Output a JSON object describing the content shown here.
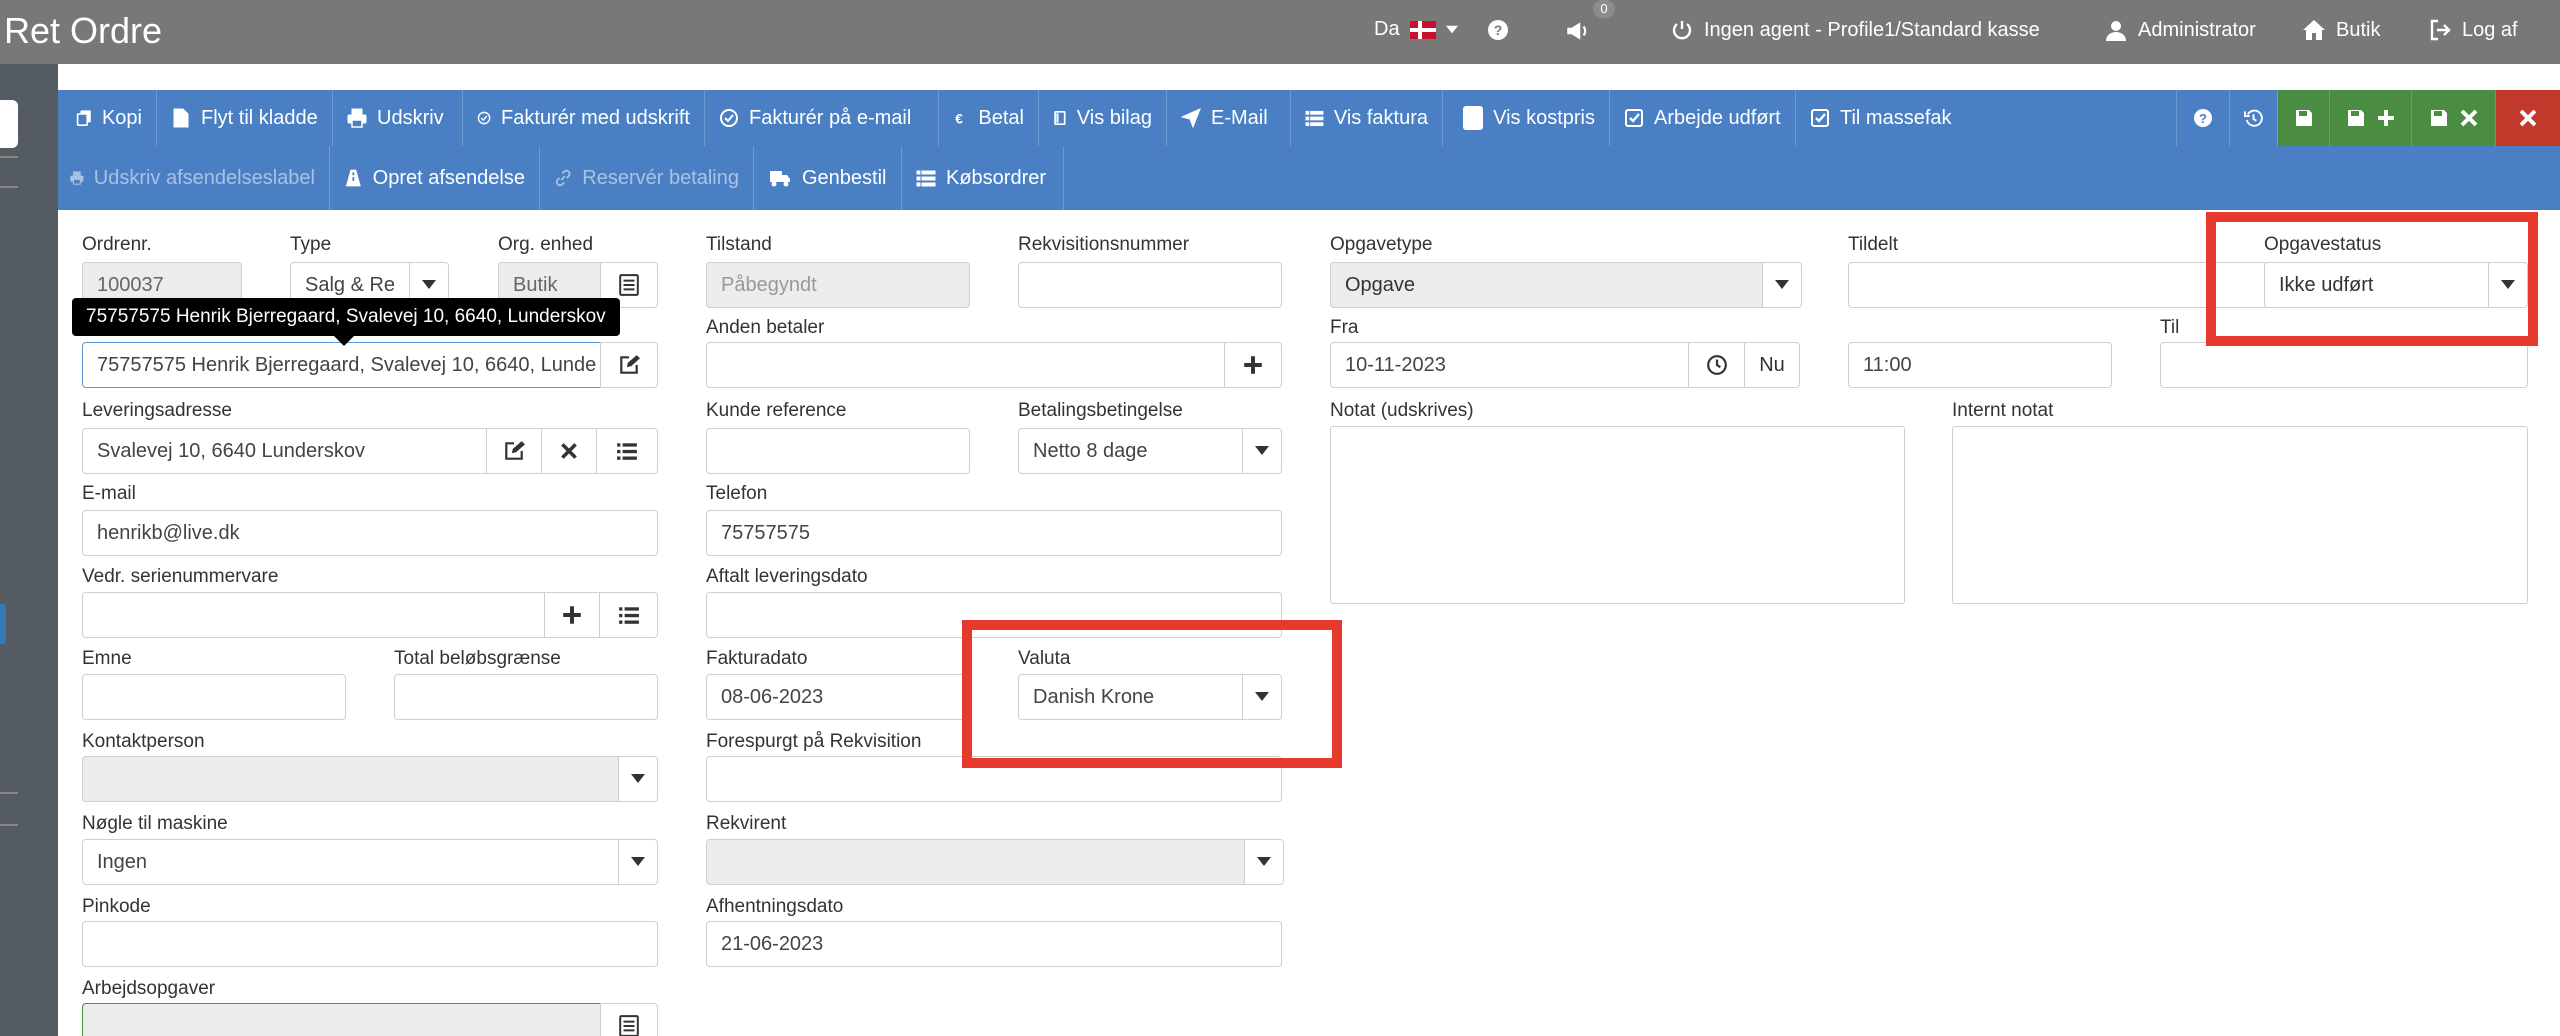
{
  "header": {
    "title": "Ret Ordre",
    "language": "Da",
    "notification_count": "0",
    "agent_status": "Ingen agent - Profile1/Standard kasse",
    "user": "Administrator",
    "shop": "Butik",
    "logout": "Log af"
  },
  "toolbar": {
    "row1": [
      "Kopi",
      "Flyt til kladde",
      "Udskriv",
      "Fakturér med udskrift",
      "Fakturér på e-mail",
      "Betal",
      "Vis bilag",
      "E-Mail",
      "Vis faktura",
      "Vis kostpris",
      "Arbejde udført",
      "Til massefak"
    ],
    "row2": [
      "Udskriv afsendelseslabel",
      "Opret afsendelse",
      "Reservér betaling",
      "Genbestil",
      "Købsordrer"
    ]
  },
  "tooltip": "75757575 Henrik Bjerregaard, Svalevej 10, 6640, Lunderskov",
  "form": {
    "ordrenr": {
      "label": "Ordrenr.",
      "value": "100037"
    },
    "type": {
      "label": "Type",
      "value": "Salg & Re"
    },
    "org_enhed": {
      "label": "Org. enhed",
      "value": "Butik"
    },
    "kunde": {
      "value": "75757575 Henrik Bjerregaard, Svalevej 10, 6640, Lunde"
    },
    "leveringsadresse": {
      "label": "Leveringsadresse",
      "value": "Svalevej 10, 6640 Lunderskov"
    },
    "email": {
      "label": "E-mail",
      "value": "henrikb@live.dk"
    },
    "serienummer": {
      "label": "Vedr. serienummervare",
      "value": ""
    },
    "emne": {
      "label": "Emne",
      "value": ""
    },
    "total_beloeb": {
      "label": "Total beløbsgrænse",
      "value": ""
    },
    "kontaktperson": {
      "label": "Kontaktperson",
      "value": ""
    },
    "noegle": {
      "label": "Nøgle til maskine",
      "value": "Ingen"
    },
    "pinkode": {
      "label": "Pinkode",
      "value": ""
    },
    "arbejdsopgaver": {
      "label": "Arbejdsopgaver",
      "value": ""
    },
    "tilstand": {
      "label": "Tilstand",
      "placeholder": "Påbegyndt"
    },
    "rekvisitionsnummer": {
      "label": "Rekvisitionsnummer",
      "value": ""
    },
    "anden_betaler": {
      "label": "Anden betaler",
      "value": ""
    },
    "kunde_reference": {
      "label": "Kunde reference",
      "value": ""
    },
    "betalingsbetingelse": {
      "label": "Betalingsbetingelse",
      "value": "Netto 8 dage"
    },
    "telefon": {
      "label": "Telefon",
      "value": "75757575"
    },
    "aftalt_levering": {
      "label": "Aftalt leveringsdato",
      "value": ""
    },
    "fakturadato": {
      "label": "Fakturadato",
      "value": "08-06-2023"
    },
    "valuta": {
      "label": "Valuta",
      "value": "Danish Krone"
    },
    "forespurgt": {
      "label": "Forespurgt på Rekvisition",
      "value": ""
    },
    "rekvirent": {
      "label": "Rekvirent",
      "value": ""
    },
    "afhentningsdato": {
      "label": "Afhentningsdato",
      "value": "21-06-2023"
    },
    "opgavetype": {
      "label": "Opgavetype",
      "value": "Opgave"
    },
    "tildelt": {
      "label": "Tildelt",
      "value": ""
    },
    "opgavestatus": {
      "label": "Opgavestatus",
      "value": "Ikke udført"
    },
    "fra": {
      "label": "Fra",
      "value": "10-11-2023",
      "now_label": "Nu"
    },
    "fra_tid": {
      "value": "11:00"
    },
    "til": {
      "label": "Til",
      "value": ""
    },
    "notat": {
      "label": "Notat (udskrives)"
    },
    "internt_notat": {
      "label": "Internt notat"
    }
  },
  "colors": {
    "header_bg": "#787878",
    "toolbar_bg": "#4a7fc4",
    "save_green": "#4b8c43",
    "close_red": "#c0392b",
    "highlight": "#e63a2e"
  }
}
